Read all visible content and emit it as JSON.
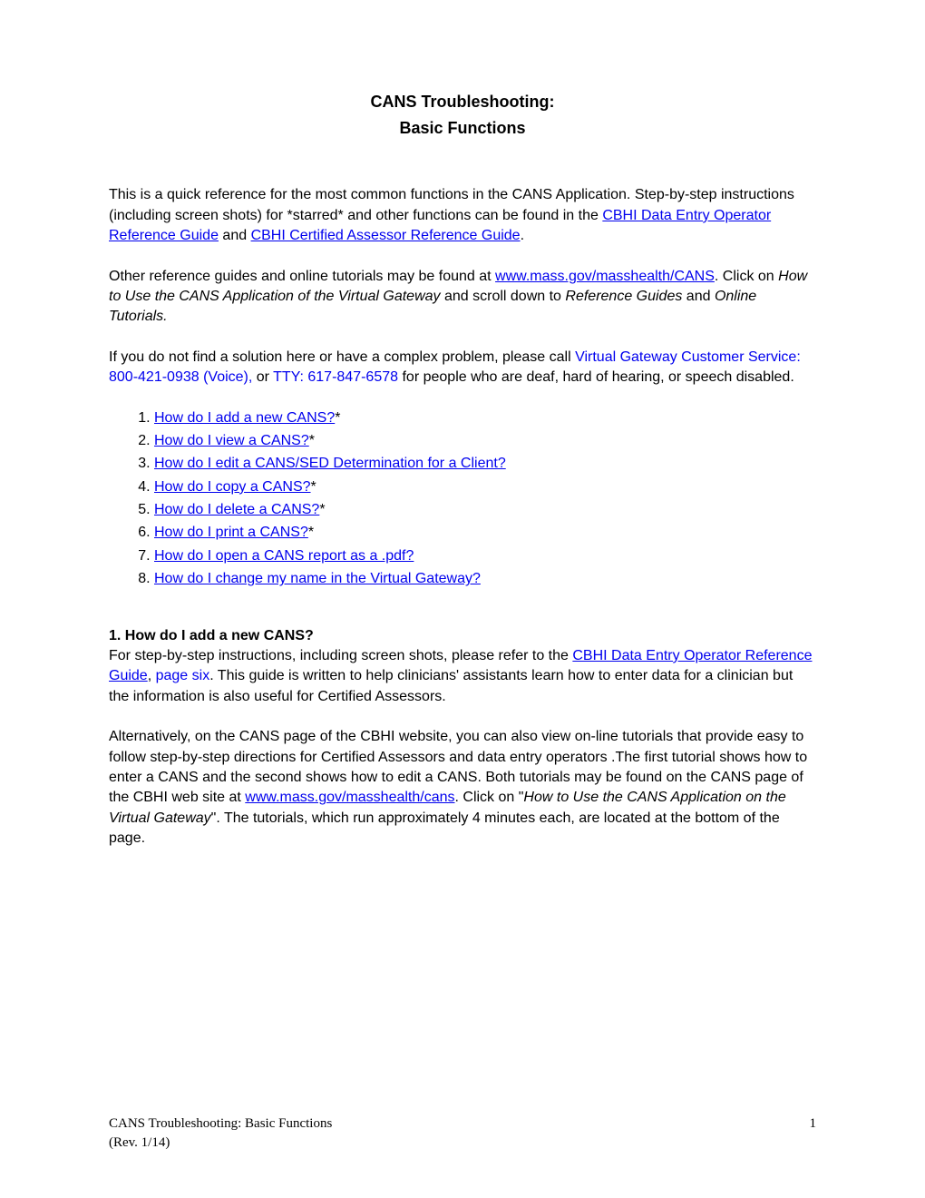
{
  "title_line1": "CANS Troubleshooting:",
  "title_line2": "Basic Functions",
  "intro": {
    "p1_a": "This is a quick reference for the most common functions in the CANS Application. Step-by-step instructions (including screen shots) for *starred* and other functions can be found in the ",
    "link1": "CBHI Data Entry Operator Reference Guide",
    "p1_b": " and ",
    "link2": "CBHI Certified Assessor Reference Guide",
    "p1_c": ".",
    "p2_a": "Other reference guides and online tutorials may be found at ",
    "link3": "www.mass.gov/masshealth/CANS",
    "p2_b": ". Click on ",
    "p2_italic1": "How to Use the CANS Application of the Virtual Gateway",
    "p2_c": " and scroll down to ",
    "p2_italic2": "Reference Guides",
    "p2_d": " and ",
    "p2_italic3": "Online Tutorials.",
    "p3_a": "If you do not find a solution here or have a complex problem, please call ",
    "p3_blue1": "Virtual Gateway Customer Service: 800-421-0938 (Voice),",
    "p3_b": " or ",
    "p3_blue2": "TTY: 617-847-6578",
    "p3_c": " for people who are deaf, hard of hearing, or speech disabled."
  },
  "toc": [
    {
      "link": "How do I add a new CANS?",
      "suffix": "*"
    },
    {
      "link": "How do I view a CANS?",
      "suffix": "*"
    },
    {
      "link": "How do I edit a CANS/SED Determination for a Client?",
      "suffix": ""
    },
    {
      "link": "How do I copy a CANS?",
      "suffix": "*"
    },
    {
      "link": "How do I delete a CANS?",
      "suffix": "*"
    },
    {
      "link": "How do I print a CANS?",
      "suffix": "*"
    },
    {
      "link": "How do I open a CANS report as a .pdf?",
      "suffix": ""
    },
    {
      "link": "How do I change my name in the Virtual Gateway?",
      "suffix": ""
    }
  ],
  "section1": {
    "heading": "1.  How do I add a new CANS?",
    "p1_a": "For step-by-step instructions, including screen shots, please refer to the ",
    "link1": "CBHI Data Entry Operator Reference Guide",
    "p1_b": ", ",
    "blue1": "page six",
    "p1_c": ". This guide is written to help clinicians' assistants learn how to enter data for a clinician but the information is also useful for Certified Assessors.",
    "p2_a": "Alternatively, on the CANS page of the CBHI website, you can also view on-line tutorials that provide easy to follow step-by-step directions for Certified Assessors and data entry operators .The first tutorial shows how to enter a CANS and the second shows how to edit a CANS. Both tutorials may be found on the CANS page of the CBHI web site at ",
    "link2": "www.mass.gov/masshealth/cans",
    "p2_b": ". Click on \"",
    "p2_italic1": "How to Use the CANS Application on the Virtual Gateway",
    "p2_c": "\". The tutorials, which run approximately 4 minutes each, are located at the bottom of the page."
  },
  "footer": {
    "left_line1": "CANS Troubleshooting: Basic Functions",
    "left_line2": "(Rev. 1/14)",
    "page_num": "1"
  }
}
